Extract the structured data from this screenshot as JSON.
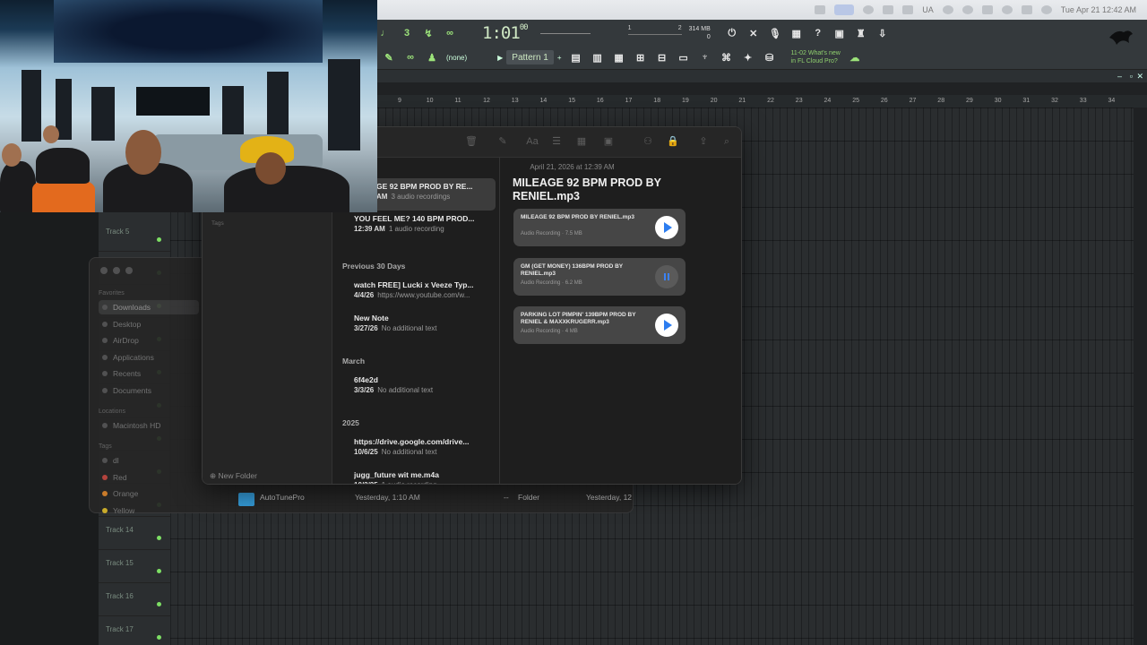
{
  "menubar": {
    "date_time": "Tue Apr 21  12:42 AM",
    "input_label": "UA"
  },
  "fl": {
    "time_main": "1:01",
    "time_sub": "00",
    "time_top": "B:S:T",
    "mem_top": "314 MB",
    "mem_bottom": "0",
    "meter_left": "1",
    "meter_right": "2",
    "pattern_none": "(none)",
    "pattern_label": "Pattern 1",
    "whats_new_1": "11-02 What's new",
    "whats_new_2": "in FL Cloud Pro?",
    "ruler": [
      "9",
      "10",
      "11",
      "12",
      "13",
      "14",
      "15",
      "16",
      "17",
      "18",
      "19",
      "20",
      "21",
      "22",
      "23",
      "24",
      "25",
      "26",
      "27",
      "28",
      "29",
      "30",
      "31",
      "32",
      "33",
      "34"
    ],
    "tracks": [
      {
        "name": "Track 5"
      },
      {
        "name": ""
      },
      {
        "name": ""
      },
      {
        "name": ""
      },
      {
        "name": ""
      },
      {
        "name": ""
      },
      {
        "name": ""
      },
      {
        "name": ""
      },
      {
        "name": ""
      },
      {
        "name": "Track 14"
      },
      {
        "name": "Track 15"
      },
      {
        "name": "Track 16"
      },
      {
        "name": "Track 17"
      }
    ]
  },
  "finder": {
    "sidebar": {
      "favorites_header": "Favorites",
      "favorites": [
        "Downloads",
        "Desktop",
        "AirDrop",
        "Applications",
        "Recents",
        "Documents"
      ],
      "locations_header": "Locations",
      "locations": [
        "Macintosh HD"
      ],
      "tags_header": "Tags",
      "tags": [
        {
          "name": "dl",
          "color": "#555555"
        },
        {
          "name": "Red",
          "color": "#c0453f"
        },
        {
          "name": "Orange",
          "color": "#d7822a"
        },
        {
          "name": "Yellow",
          "color": "#d7b62a"
        }
      ]
    },
    "row": {
      "name": "AutoTunePro",
      "modified": "Yesterday, 1:10 AM",
      "size": "--",
      "kind": "Folder",
      "added": "Yesterday, 12"
    }
  },
  "notes": {
    "folders": {
      "tags_label": "Tags",
      "new_folder": "New Folder"
    },
    "list": {
      "sections": [
        {
          "label": "Previous 30 Days"
        },
        {
          "label": "March"
        },
        {
          "label": "2025"
        }
      ],
      "items": [
        {
          "title": "GE 92 BPM PROD BY RE...",
          "meta_time": "AM",
          "meta_text": "3 audio recordings"
        },
        {
          "title": "YOU FEEL ME? 140 BPM PROD...",
          "meta_time": "12:39 AM",
          "meta_text": "1 audio recording"
        },
        {
          "title": "watch FREE] Lucki x Veeze Typ...",
          "meta_time": "4/4/26",
          "meta_text": "https://www.youtube.com/w..."
        },
        {
          "title": "New Note",
          "meta_time": "3/27/26",
          "meta_text": "No additional text"
        },
        {
          "title": "6f4e2d",
          "meta_time": "3/3/26",
          "meta_text": "No additional text"
        },
        {
          "title": "https://drive.google.com/drive...",
          "meta_time": "10/6/25",
          "meta_text": "No additional text"
        },
        {
          "title": "jugg_future wit me.m4a",
          "meta_time": "10/2/25",
          "meta_text": "1 audio recording"
        }
      ]
    },
    "content": {
      "date": "April 21, 2026 at 12:39 AM",
      "title": "MILEAGE 92 BPM PROD BY RENIEL.mp3",
      "recordings": [
        {
          "name": "MILEAGE 92 BPM PROD BY RENIEL.mp3",
          "meta": "Audio Recording · 7.5 MB",
          "state": "play"
        },
        {
          "name": "GM (GET MONEY) 136BPM PROD BY RENIEL.mp3",
          "meta": "Audio Recording · 6.2 MB",
          "state": "paused"
        },
        {
          "name": "PARKING LOT PIMPIN' 139BPM PROD BY RENIEL & MAXXKRUGERR.mp3",
          "meta": "Audio Recording · 4 MB",
          "state": "play"
        }
      ]
    }
  },
  "colors": {
    "fl_accent": "#9ce37a",
    "track_led": "#7ddf64",
    "play_blue": "#2c7df0",
    "folder_blue": "#36a6e8"
  }
}
